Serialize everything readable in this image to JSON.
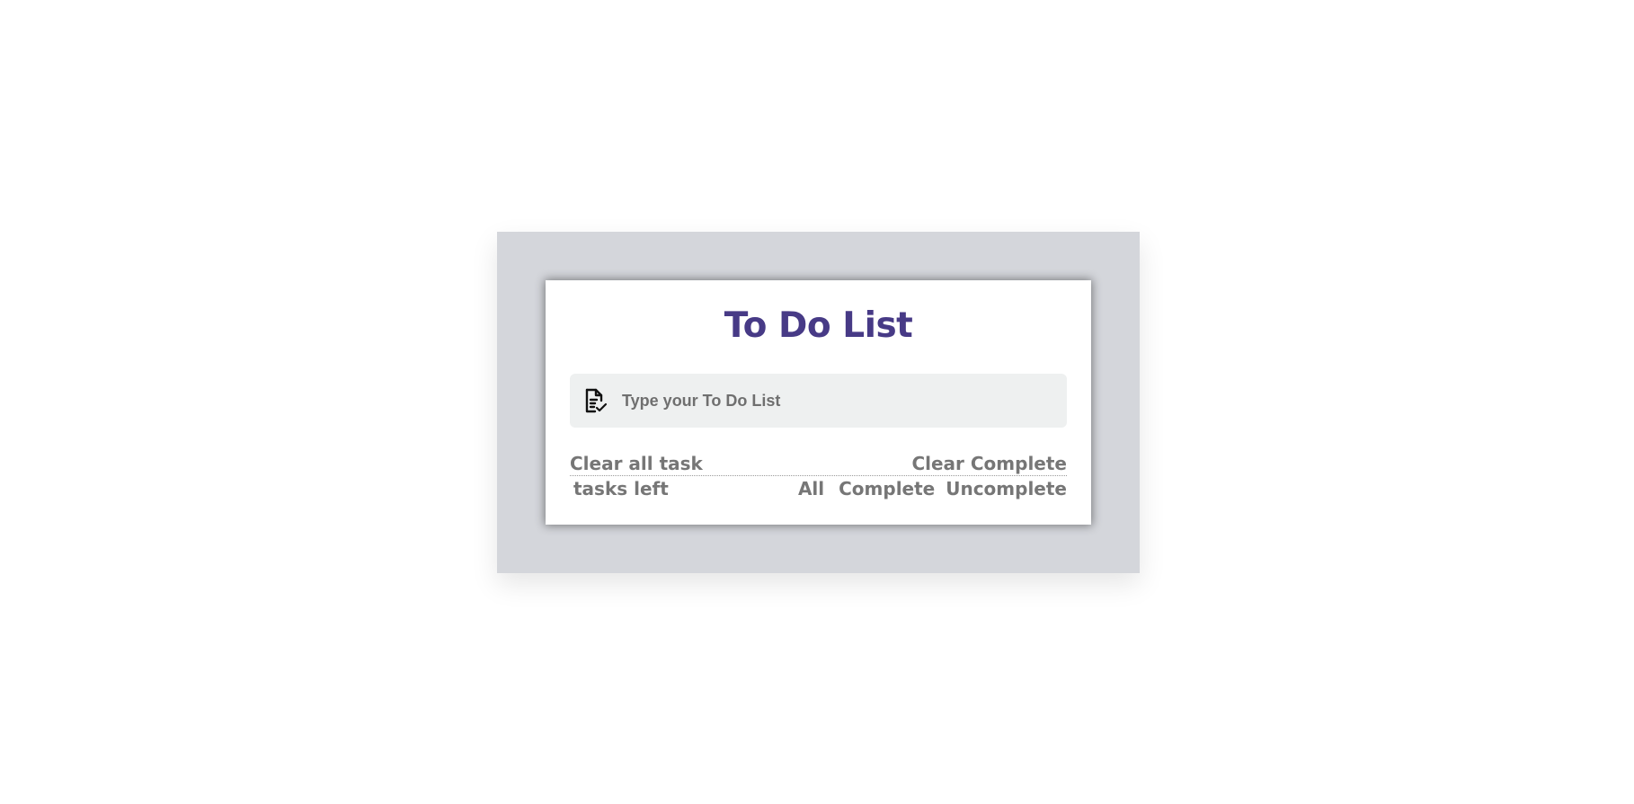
{
  "app": {
    "title": "To Do List"
  },
  "input": {
    "placeholder": "Type your To Do List",
    "value": "",
    "icon": "task-list-icon"
  },
  "actions": {
    "clear_all_label": "Clear all task",
    "clear_complete_label": "Clear Complete"
  },
  "status": {
    "tasks_left_label": "tasks left"
  },
  "filters": [
    {
      "label": "All"
    },
    {
      "label": "Complete"
    },
    {
      "label": "Uncomplete"
    }
  ],
  "colors": {
    "title": "#473a86",
    "panel_background": "#d4d6db",
    "input_background": "#eef0f0",
    "muted_text": "#767676"
  }
}
